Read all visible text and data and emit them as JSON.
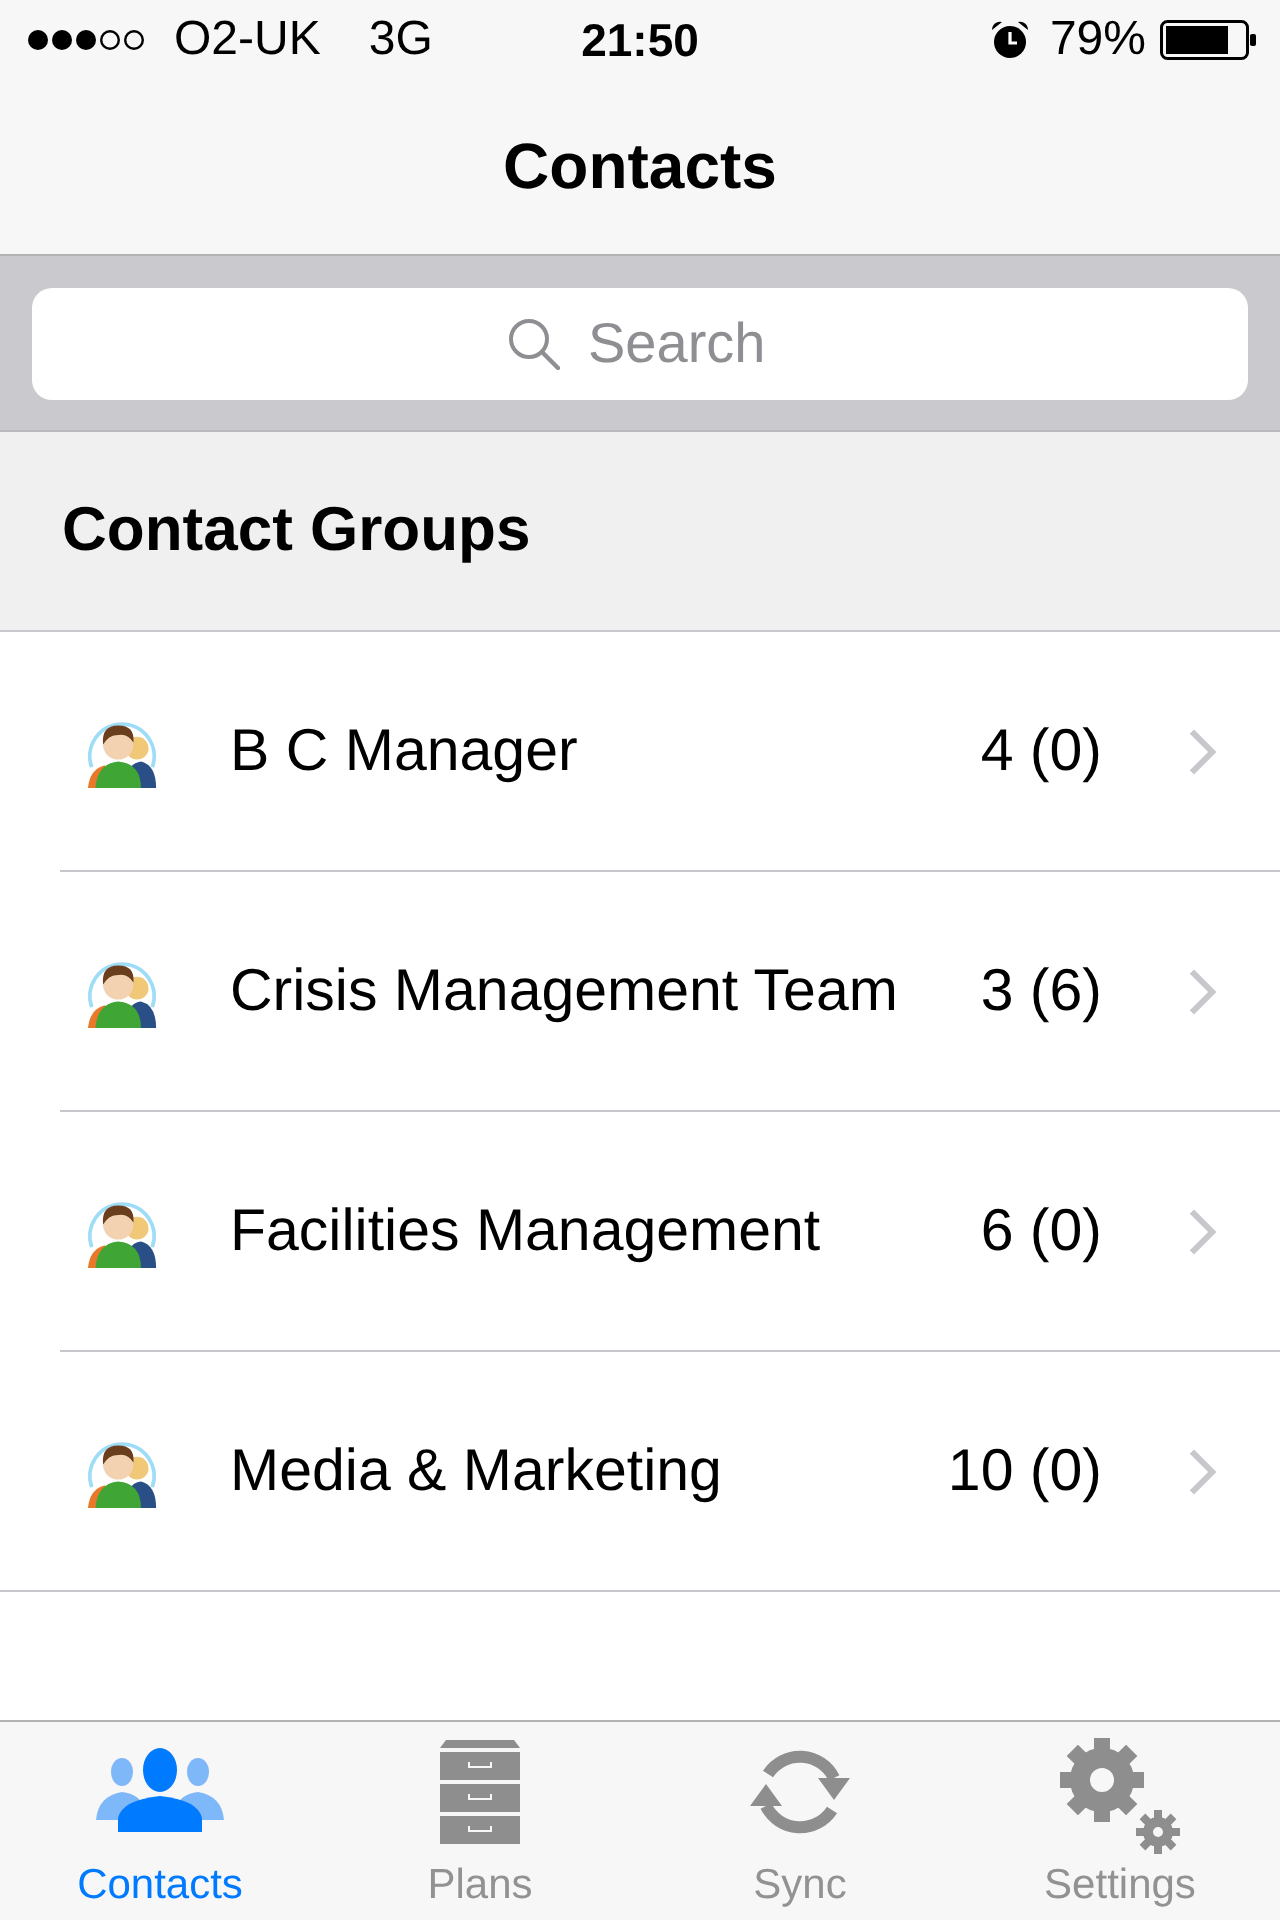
{
  "status_bar": {
    "carrier": "O2-UK",
    "network": "3G",
    "time": "21:50",
    "battery": "79%"
  },
  "nav_bar": {
    "title": "Contacts"
  },
  "search": {
    "placeholder": "Search"
  },
  "section": {
    "title": "Contact Groups"
  },
  "groups": [
    {
      "name": "B C Manager",
      "count": "4 (0)"
    },
    {
      "name": "Crisis Management Team",
      "count": "3 (6)"
    },
    {
      "name": "Facilities Management",
      "count": "6 (0)"
    },
    {
      "name": "Media & Marketing",
      "count": "10 (0)"
    }
  ],
  "tab_bar": {
    "tabs": [
      {
        "label": "Contacts",
        "kind": "contacts",
        "selected": true
      },
      {
        "label": "Plans",
        "kind": "plans",
        "selected": false
      },
      {
        "label": "Sync",
        "kind": "sync",
        "selected": false
      },
      {
        "label": "Settings",
        "kind": "settings",
        "selected": false
      }
    ]
  }
}
